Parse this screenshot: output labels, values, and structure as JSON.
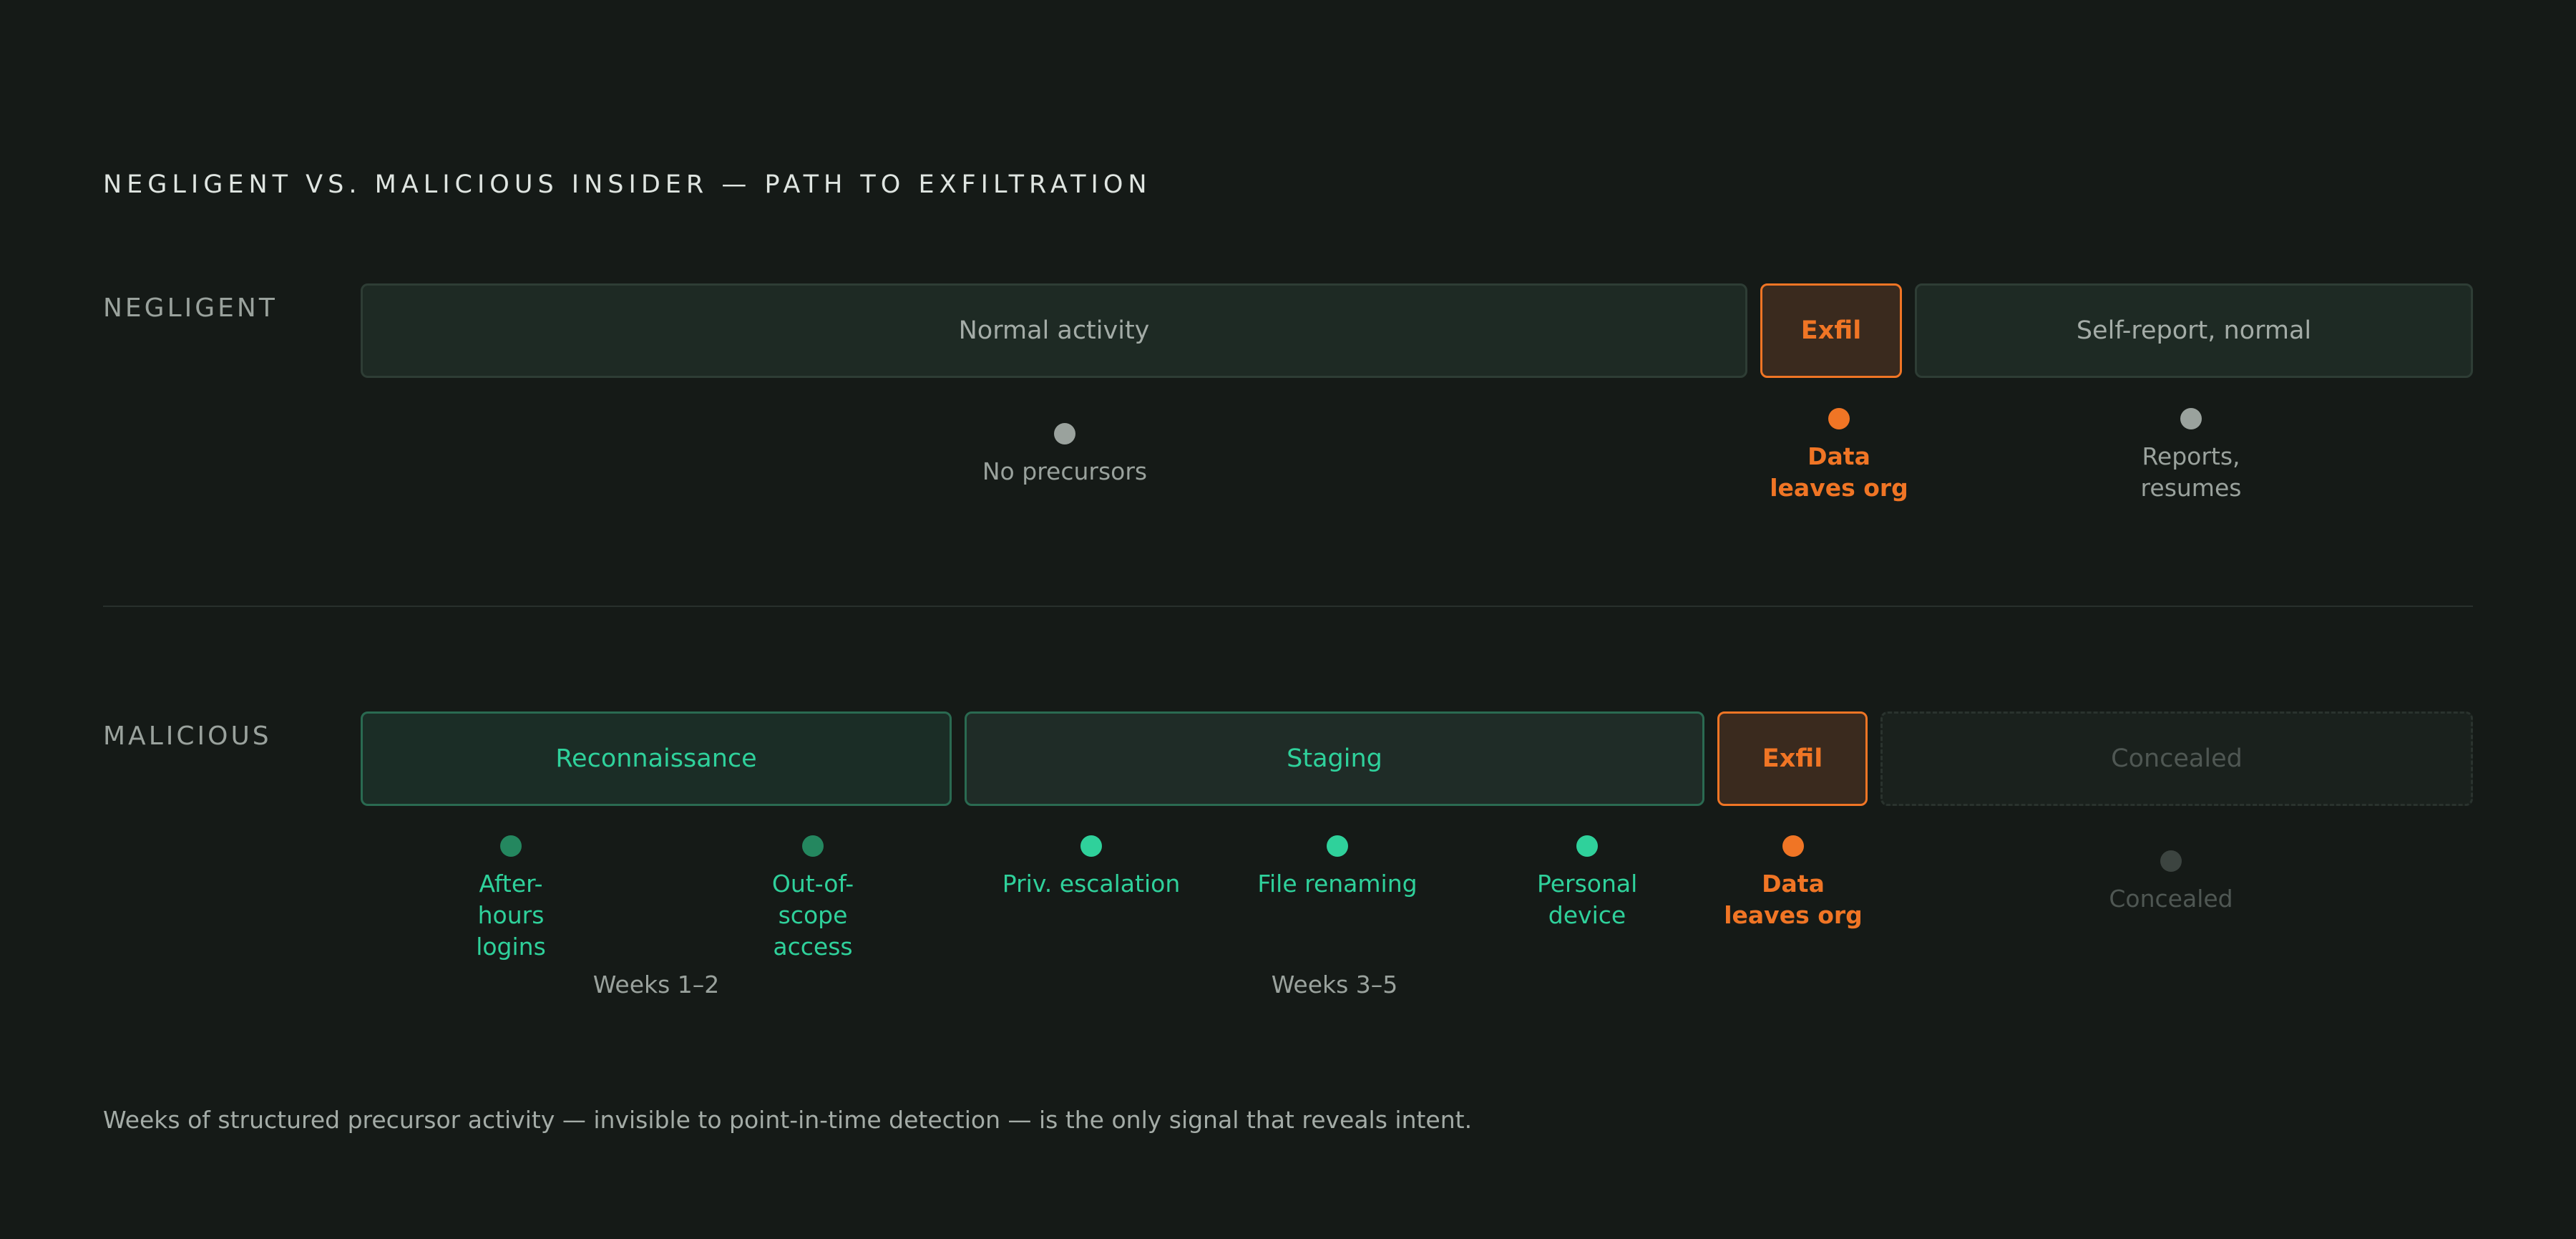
{
  "title": "NEGLIGENT VS. MALICIOUS INSIDER — PATH TO EXFILTRATION",
  "negligent": {
    "label": "NEGLIGENT",
    "phases": [
      "Normal activity",
      "Exfil",
      "Self-report, normal"
    ],
    "events": {
      "no_precursors": "No precursors",
      "data_leaves": "Data leaves org",
      "reports": "Reports, resumes"
    }
  },
  "malicious": {
    "label": "MALICIOUS",
    "phases": [
      "Reconnaissance",
      "Staging",
      "Exfil",
      "Concealed"
    ],
    "events": {
      "after_hours": "After-hours logins",
      "out_of_scope": "Out-of-scope access",
      "priv_escalation": "Priv. escalation",
      "file_renaming": "File renaming",
      "personal_device": "Personal device",
      "data_leaves": "Data leaves org",
      "concealed": "Concealed"
    },
    "spans": [
      "Weeks 1–2",
      "Weeks 3–5"
    ]
  },
  "footnote": "Weeks of structured precursor activity — invisible to point-in-time detection — is the only signal that reveals intent.",
  "colors": {
    "background": "#151a17",
    "accent_green": "#2fd19b",
    "exfil_orange": "#f07525",
    "neutral_gray": "#9aa29d"
  }
}
